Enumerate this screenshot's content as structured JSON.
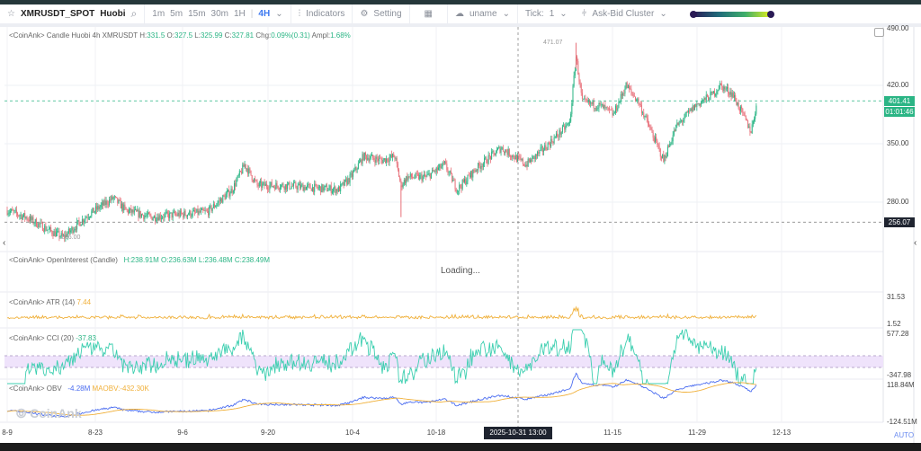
{
  "toolbar": {
    "symbol": "XMRUSDT_SPOT",
    "exchange": "Huobi",
    "intervals": [
      "1m",
      "5m",
      "15m",
      "30m",
      "1H"
    ],
    "active_interval": "4H",
    "indicators": "Indicators",
    "setting": "Setting",
    "user": "uname",
    "tick_label": "Tick:",
    "tick_value": "1",
    "cluster": "Ask-Bid Cluster"
  },
  "main_legend": {
    "prefix": "<CoinAnk> Candle  Huobi 4h XMRUSDT",
    "h_label": "H:",
    "h": "331.5",
    "o_label": "O:",
    "o": "327.5",
    "l_label": "L:",
    "l": "325.99",
    "c_label": "C:",
    "c": "327.81",
    "chg_label": "Chg:",
    "chg": "0.09%(0.31)",
    "ampl_label": "Ampl:",
    "ampl": "1.68%"
  },
  "oi_legend": {
    "prefix": "<CoinAnk> OpenInterest (Candle)",
    "h": "H:238.91M",
    "o": "O:236.63M",
    "l": "L:236.48M",
    "c": "C:238.49M",
    "status": "Loading..."
  },
  "atr_legend": {
    "prefix": "<CoinAnk> ATR  (14)",
    "value": "7.44",
    "axis": [
      "31.53",
      "1.52"
    ]
  },
  "cci_legend": {
    "prefix": "<CoinAnk> CCI  (20)",
    "value": "-37.83",
    "axis": [
      "577.28",
      "-347.98"
    ]
  },
  "obv_legend": {
    "prefix": "<CoinAnk> OBV",
    "obv": "-4.28M",
    "maobv": "MAOBV:-432.30K",
    "axis": [
      "118.84M",
      "-124.51M"
    ]
  },
  "price_axis": [
    "490.00",
    "420.00",
    "350.00",
    "280.00"
  ],
  "annotations": {
    "high": "471.07",
    "low": "236.00",
    "last_price": "401.41",
    "countdown": "01:01:46",
    "cross_price": "256.07",
    "cross_time": "2025-10-31 13:00"
  },
  "x_axis": [
    "8-9",
    "8-23",
    "9-6",
    "9-20",
    "10-4",
    "10-18",
    "11-15",
    "11-29",
    "12-13"
  ],
  "watermark": "CoinAnk",
  "auto_label": "AUTO",
  "colors": {
    "up": "#2bb585",
    "down": "#e8707a",
    "atr": "#f0b03a",
    "cci": "#3ccfb0",
    "obv": "#4a6cf0",
    "maobv": "#f0b03a",
    "last": "#2bb585"
  },
  "chart_data": {
    "type": "candlestick",
    "interval": "4h",
    "closes_keypoints": [
      [
        "8-9",
        270
      ],
      [
        "8-12",
        262
      ],
      [
        "8-16",
        245
      ],
      [
        "8-18",
        238
      ],
      [
        "8-22",
        265
      ],
      [
        "8-26",
        285
      ],
      [
        "8-28",
        270
      ],
      [
        "9-1",
        262
      ],
      [
        "9-5",
        265
      ],
      [
        "9-10",
        268
      ],
      [
        "9-14",
        295
      ],
      [
        "9-16",
        325
      ],
      [
        "9-18",
        300
      ],
      [
        "9-22",
        300
      ],
      [
        "10-1",
        295
      ],
      [
        "10-3",
        310
      ],
      [
        "10-5",
        335
      ],
      [
        "10-8",
        330
      ],
      [
        "10-10",
        335
      ],
      [
        "10-11",
        300
      ],
      [
        "10-12",
        310
      ],
      [
        "10-15",
        310
      ],
      [
        "10-18",
        325
      ],
      [
        "10-20",
        295
      ],
      [
        "10-23",
        320
      ],
      [
        "10-27",
        345
      ],
      [
        "10-31",
        325
      ],
      [
        "11-3",
        345
      ],
      [
        "11-5",
        360
      ],
      [
        "11-7",
        375
      ],
      [
        "11-8",
        455
      ],
      [
        "11-9",
        400
      ],
      [
        "11-12",
        395
      ],
      [
        "11-14",
        385
      ],
      [
        "11-16",
        420
      ],
      [
        "11-18",
        400
      ],
      [
        "11-20",
        365
      ],
      [
        "11-22",
        330
      ],
      [
        "11-24",
        370
      ],
      [
        "11-27",
        395
      ],
      [
        "11-30",
        410
      ],
      [
        "12-1",
        420
      ],
      [
        "12-3",
        410
      ],
      [
        "12-5",
        380
      ],
      [
        "12-6",
        365
      ],
      [
        "12-7",
        401.41
      ]
    ],
    "ylim": [
      230,
      490
    ]
  }
}
